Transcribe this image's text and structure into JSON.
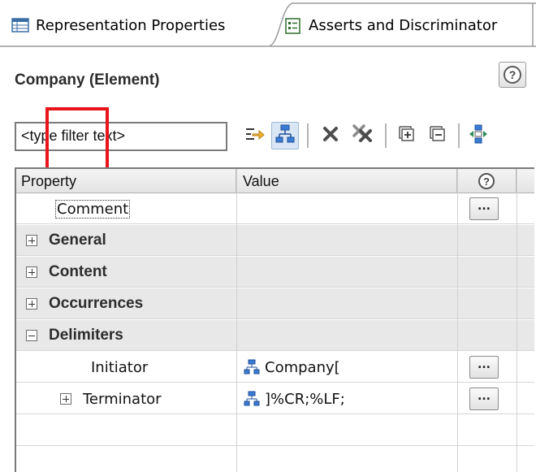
{
  "tabs": [
    {
      "label": "Representation Properties",
      "icon": "properties-table-icon",
      "active": true
    },
    {
      "label": "Asserts and Discriminator",
      "icon": "asserts-list-icon",
      "active": false
    }
  ],
  "header": {
    "title": "Company (Element)",
    "help_icon": "help-icon"
  },
  "filter": {
    "value": "<type filter text>"
  },
  "toolbar": [
    {
      "name": "show-advanced-icon"
    },
    {
      "name": "show-hierarchy-icon",
      "pressed": true
    },
    {
      "name": "delete-icon"
    },
    {
      "name": "delete-all-icon"
    },
    {
      "name": "expand-all-icon"
    },
    {
      "name": "collapse-all-icon"
    },
    {
      "name": "layout-icon"
    }
  ],
  "table": {
    "columns": {
      "property": "Property",
      "value": "Value",
      "help": "?"
    },
    "rows": [
      {
        "type": "leaf",
        "property": "Comment",
        "value": "",
        "has_button": true,
        "button": "..."
      },
      {
        "type": "category",
        "property": "General",
        "expanded": false
      },
      {
        "type": "category",
        "property": "Content",
        "expanded": false
      },
      {
        "type": "category",
        "property": "Occurrences",
        "expanded": false
      },
      {
        "type": "category",
        "property": "Delimiters",
        "expanded": true
      },
      {
        "type": "leaf",
        "property": "Initiator",
        "value": "Company[",
        "value_icon": "hierarchy-icon",
        "has_button": true,
        "button": "..."
      },
      {
        "type": "leaf",
        "property": "Terminator",
        "value": "]%CR;%LF;",
        "value_icon": "hierarchy-icon",
        "expander": "plus",
        "has_button": true,
        "button": "..."
      }
    ]
  },
  "colors": {
    "highlight": "#e8151b",
    "category_bg": "#e8e8e8"
  }
}
